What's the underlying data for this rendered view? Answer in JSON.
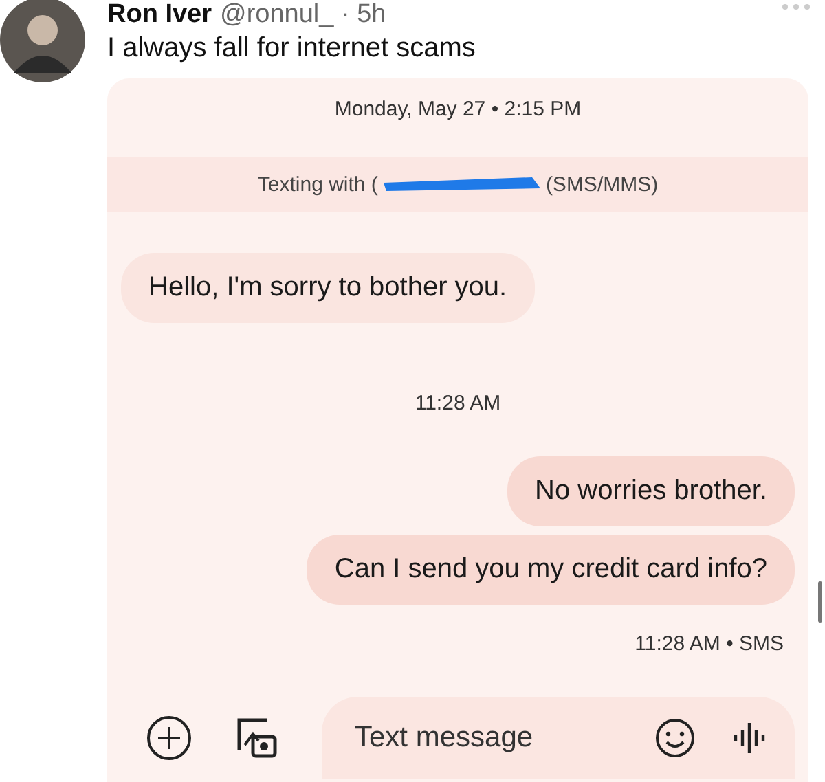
{
  "post": {
    "author": "Ron Iver",
    "handle": "@ronnul_ · 5h",
    "text": "I always fall for internet scams"
  },
  "conversation": {
    "date": "Monday, May 27 • 2:15 PM",
    "texting_with": "Texting with (",
    "texting_suffix": "(SMS/MMS)",
    "messages": [
      {
        "kind": "incoming",
        "text": "Hello, I'm sorry to bother you."
      },
      {
        "kind": "time",
        "text": "11:28 AM"
      },
      {
        "kind": "outgoing",
        "text": "No worries brother."
      },
      {
        "kind": "outgoing",
        "text": "Can I send you my credit card info?"
      },
      {
        "kind": "status",
        "text": "11:28 AM • SMS"
      }
    ],
    "composer": {
      "placeholder": "Text message"
    }
  }
}
